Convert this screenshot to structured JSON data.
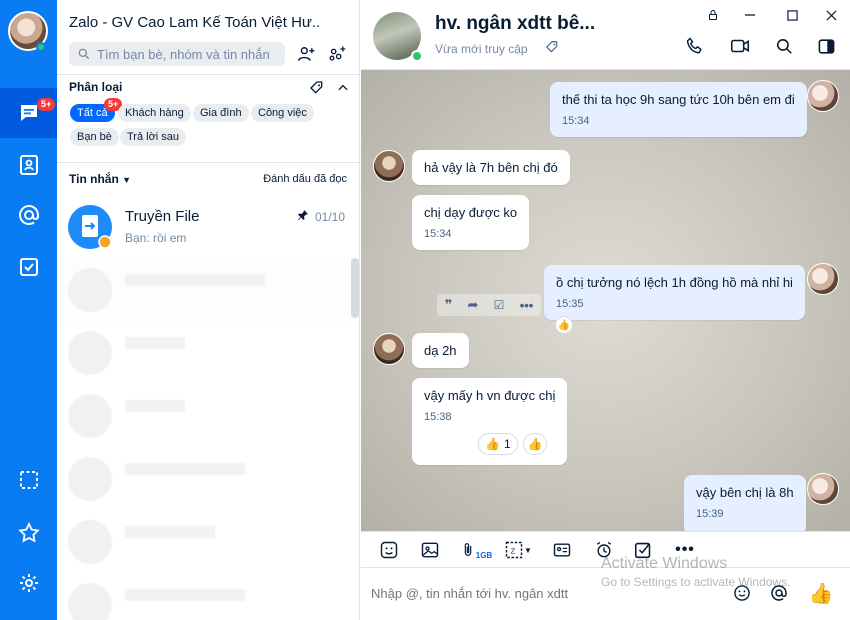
{
  "app": {
    "title": "Zalo - GV Cao Lam Kế Toán Việt Hư..."
  },
  "rail": {
    "items": [
      {
        "icon": "chat-icon",
        "badge": "5+"
      },
      {
        "icon": "contacts-icon"
      },
      {
        "icon": "at-icon"
      },
      {
        "icon": "todo-check-icon"
      },
      {
        "icon": "screenshot-icon"
      },
      {
        "icon": "star-icon"
      },
      {
        "icon": "settings-icon"
      }
    ]
  },
  "search": {
    "placeholder": "Tìm bạn bè, nhóm và tin nhắn"
  },
  "filter": {
    "label": "Phân loại",
    "chips": [
      "Tất cả",
      "Khách hàng",
      "Gia đình",
      "Công việc",
      "Bạn bè",
      "Trả lời sau"
    ],
    "active_badge": "5+"
  },
  "list": {
    "tab_label": "Tin nhắn",
    "mark_read": "Đánh dấu đã đọc",
    "items": [
      {
        "name": "Truyền File",
        "preview": "Bạn: rồi em",
        "time": "01/10",
        "pinned": true
      }
    ]
  },
  "chat": {
    "name": "hv. ngân xdtt bê...",
    "status": "Vừa mới truy cập",
    "messages": [
      {
        "from": "me",
        "text": "thế thi ta học 9h sang tức 10h bên em đi",
        "time": "15:34"
      },
      {
        "from": "them",
        "text": "hả vậy là 7h bên chị đó"
      },
      {
        "from": "them",
        "text": "chị dạy được ko",
        "time": "15:34"
      },
      {
        "from": "me",
        "text": "ồ chị tưởng nó lệch 1h đồng hồ mà nhỉ hi",
        "time": "15:35"
      },
      {
        "from": "them",
        "text": "dạ 2h"
      },
      {
        "from": "them",
        "text": "vậy mấy h vn được chị",
        "time": "15:38",
        "reaction_count": "1"
      },
      {
        "from": "me",
        "text": "vậy bên chị là 8h",
        "time": "15:39"
      }
    ]
  },
  "composer": {
    "placeholder": "Nhập @, tin nhắn tới hv. ngân xdtt",
    "file_size_label": "1GB"
  },
  "watermark": {
    "line1": "Activate Windows",
    "line2": "Go to Settings to activate Windows."
  }
}
